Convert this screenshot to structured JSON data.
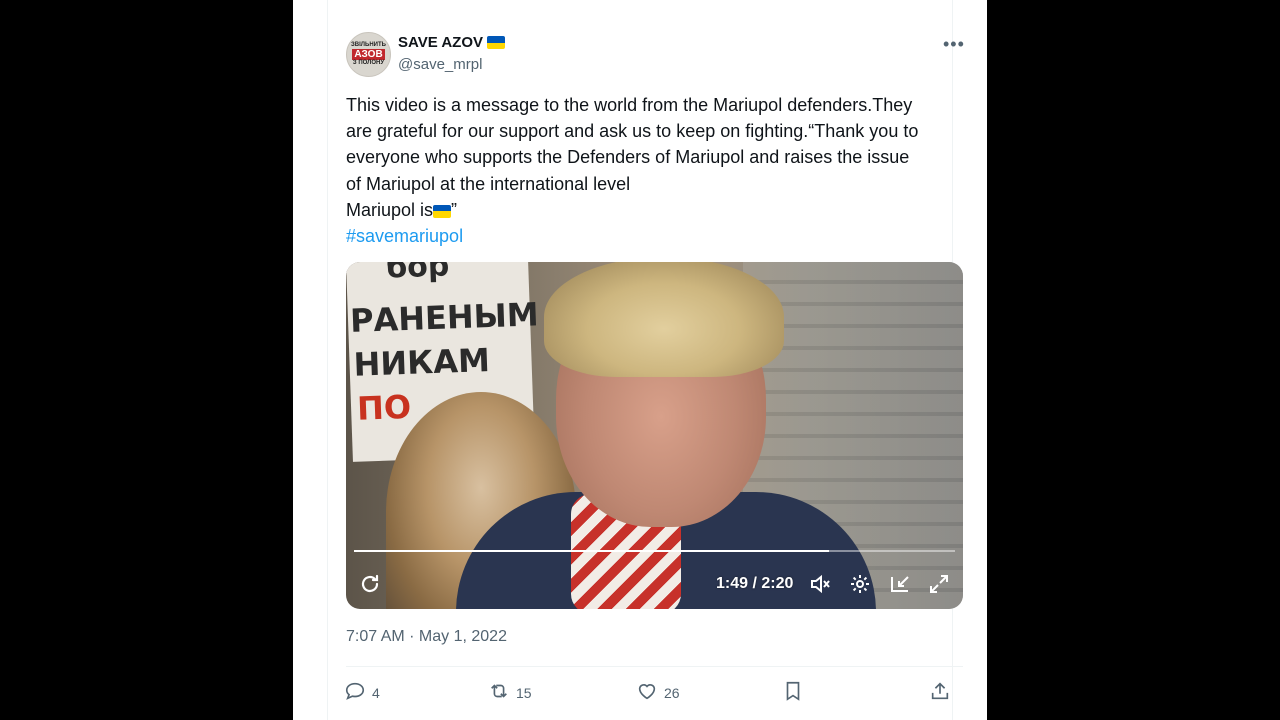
{
  "author": {
    "display_name": "SAVE AZOV",
    "handle": "@save_mrpl",
    "avatar_text": [
      "ЗВІЛЬНИТЬ",
      "АЗОВ",
      "З ПОЛОНУ"
    ]
  },
  "tweet": {
    "lines": [
      "This video is a message to the world from the Mariupol defenders.They",
      "are grateful for our support and ask us to keep on fighting.“Thank you to",
      "everyone who supports the Defenders of Mariupol and raises the issue",
      "of Mariupol at the international level"
    ],
    "last_line_prefix": "Mariupol is",
    "last_line_suffix": "”",
    "hashtag": "#savemariupol",
    "timestamp": "7:07 AM · May 1, 2022"
  },
  "media": {
    "sign_text": [
      "бор",
      "РАНЕНЫМ",
      "НИКАМ",
      "ПО"
    ],
    "time_display": "1:49 / 2:20",
    "progress_fraction": 0.79
  },
  "actions": {
    "replies": "4",
    "reposts": "15",
    "likes": "26"
  },
  "colors": {
    "accent": "#1d9bf0",
    "secondary_text": "#536471",
    "flag_blue": "#0057b7",
    "flag_yellow": "#ffd700"
  },
  "icons": {
    "more": "more-icon",
    "replay": "replay-icon",
    "volume": "volume-icon",
    "settings": "settings-icon",
    "pip": "pip-icon",
    "fullscreen": "fullscreen-icon",
    "reply": "reply-icon",
    "repost": "repost-icon",
    "like": "like-icon",
    "bookmark": "bookmark-icon",
    "share": "share-icon"
  }
}
